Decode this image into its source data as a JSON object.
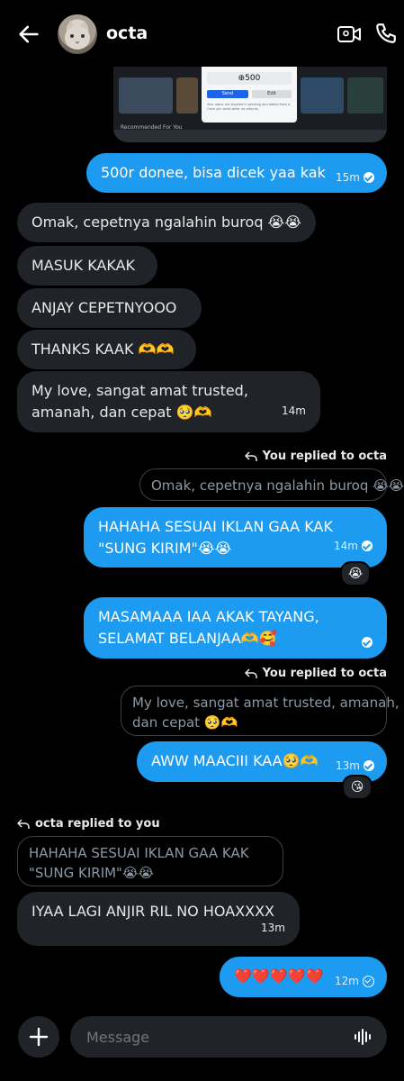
{
  "header": {
    "title": "octa"
  },
  "screenshot": {
    "amount": "⊕500",
    "primary_btn": "Send",
    "secondary_btn": "Edit",
    "fine_print": "Your robux are stashed in pending and added from a, Once you send seller no refunds.",
    "recommended": "Recommended For You"
  },
  "messages": [
    {
      "text": "500r donee, bisa dicek yaa kak",
      "time": "15m"
    },
    {
      "text": "Omak, cepetnya ngalahin buroq 😭😭"
    },
    {
      "text": "MASUK KAKAK"
    },
    {
      "text": "ANJAY CEPETNYOOO"
    },
    {
      "text": "THANKS KAAK 🫶🫶"
    },
    {
      "line1": "My love, sangat amat trusted,",
      "line2": "amanah, dan cepat 🥺🫶",
      "time": "14m"
    },
    {
      "replied": "You replied to octa",
      "quote": "Omak, cepetnya ngalahin buroq 😭😭",
      "line1": "HAHAHA SESUAI IKLAN GAA KAK",
      "line2": "\"SUNG KIRIM\"😭😭",
      "time": "14m",
      "reaction": "😭"
    },
    {
      "line1": "MASAMAAA IAA AKAK TAYANG,",
      "line2": "SELAMAT BELANJAA🫶🥰"
    },
    {
      "replied": "You replied to octa",
      "quote1": "My love, sangat amat trusted, amanah,",
      "quote2": "dan cepat 🥺🫶",
      "text": "AWW MAACIII KAA🥺🫶",
      "time": "13m",
      "reaction": "😘"
    },
    {
      "replied": "octa replied to you",
      "quote1": "HAHAHA SESUAI IKLAN GAA KAK",
      "quote2": "\"SUNG KIRIM\"😭😭",
      "text": "IYAA LAGI ANJIR  RIL NO HOAXXXX",
      "time": "13m"
    },
    {
      "text": "❤️❤️❤️❤️❤️",
      "time": "12m"
    }
  ],
  "composer": {
    "placeholder": "Message"
  }
}
